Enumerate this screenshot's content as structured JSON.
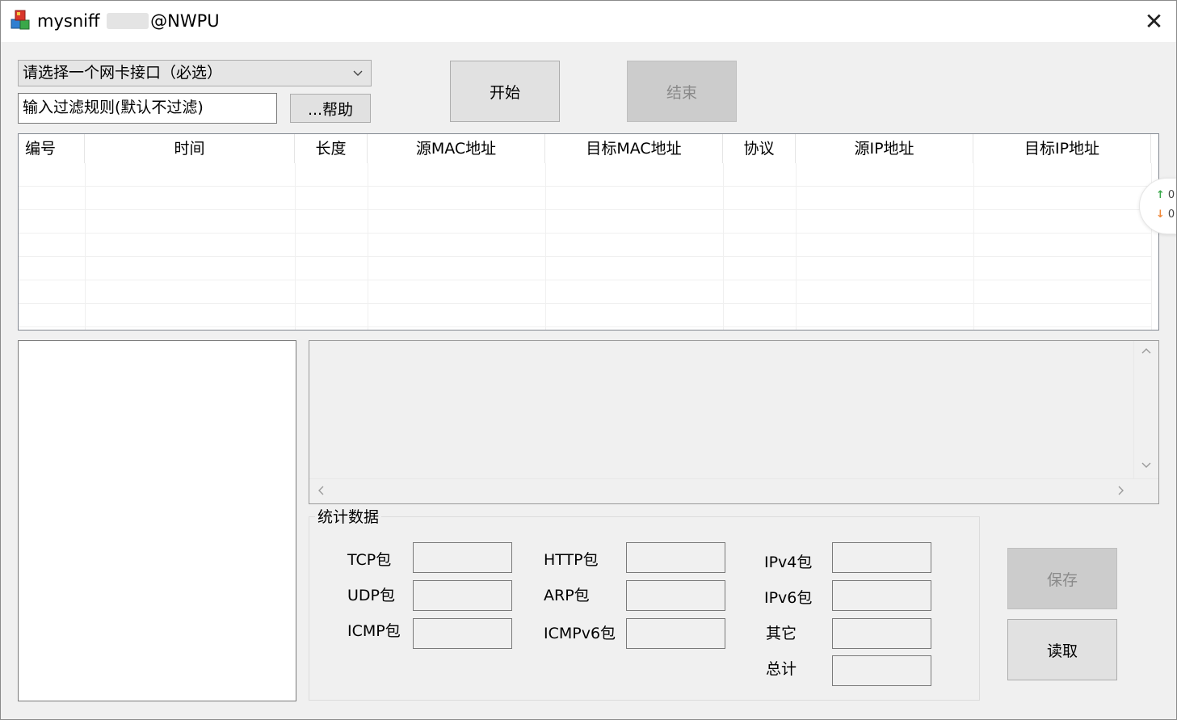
{
  "window": {
    "title_prefix": "mysniff",
    "title_suffix": "@NWPU",
    "close_glyph": "✕",
    "icon": "app-cubes-icon"
  },
  "controls": {
    "interface_select": "请选择一个网卡接口（必选）",
    "filter_input": "输入过滤规则(默认不过滤)",
    "help_button": "...帮助",
    "start_button": "开始",
    "end_button": "结束"
  },
  "table": {
    "columns": [
      "编号",
      "时间",
      "长度",
      "源MAC地址",
      "目标MAC地址",
      "协议",
      "源IP地址",
      "目标IP地址"
    ]
  },
  "float_widget": {
    "up_value": "0",
    "down_value": "0",
    "up_icon": "arrow-up-icon",
    "down_icon": "arrow-down-icon"
  },
  "stats": {
    "group_title": "统计数据",
    "tcp": "TCP包",
    "udp": "UDP包",
    "icmp": "ICMP包",
    "http": "HTTP包",
    "arp": "ARP包",
    "icmpv6": "ICMPv6包",
    "ipv4": "IPv4包",
    "ipv6": "IPv6包",
    "other": "其它",
    "total": "总计"
  },
  "actions": {
    "save_button": "保存",
    "read_button": "读取"
  }
}
